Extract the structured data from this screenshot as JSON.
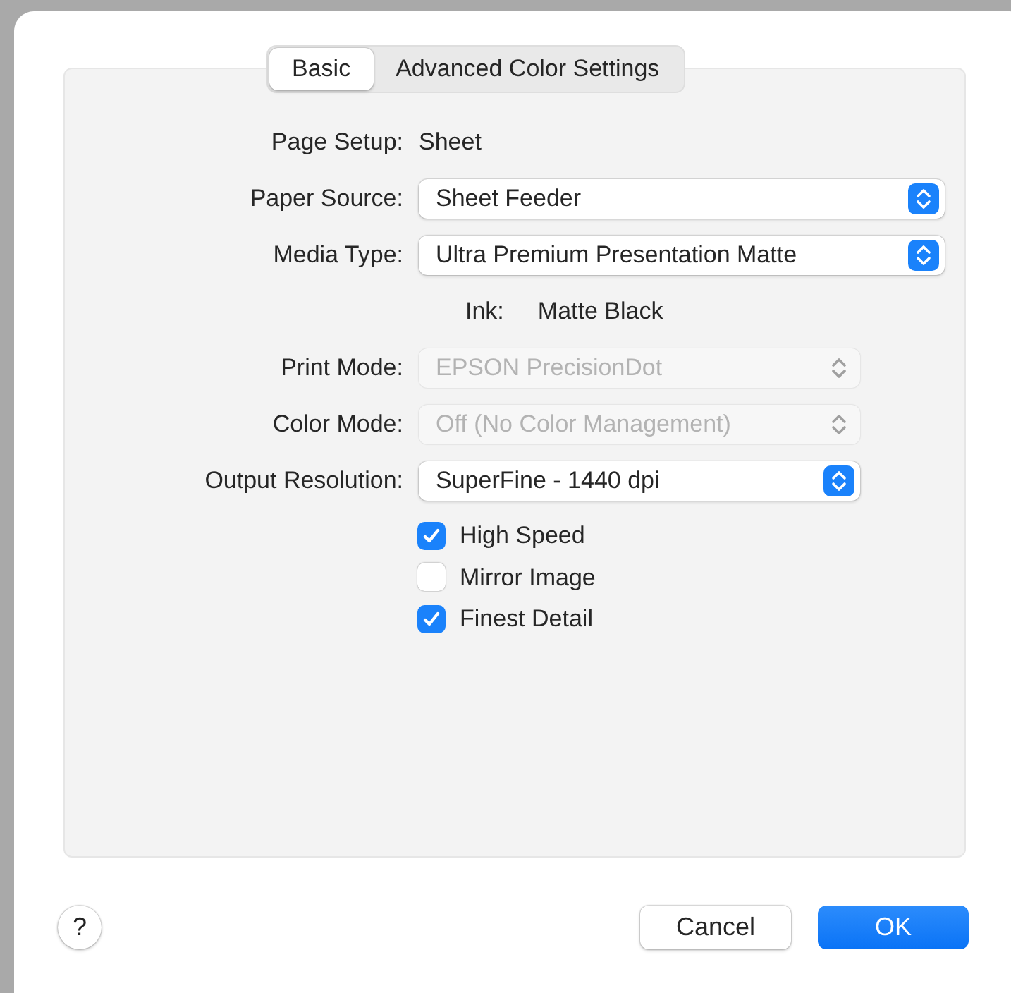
{
  "tabs": [
    {
      "label": "Basic",
      "selected": true
    },
    {
      "label": "Advanced Color Settings",
      "selected": false
    }
  ],
  "rows": [
    {
      "kind": "value",
      "label": "Page Setup:",
      "value": "Sheet"
    },
    {
      "kind": "popup_wide",
      "label": "Paper Source:",
      "value": "Sheet Feeder",
      "disabled": false
    },
    {
      "kind": "popup_wide",
      "label": "Media Type:",
      "value": "Ultra Premium Presentation Matte",
      "disabled": false
    },
    {
      "kind": "sub_value",
      "label": "Ink:",
      "value": "Matte Black"
    },
    {
      "kind": "popup",
      "label": "Print Mode:",
      "value": "EPSON PrecisionDot",
      "disabled": true
    },
    {
      "kind": "popup",
      "label": "Color Mode:",
      "value": "Off (No Color Management)",
      "disabled": true
    },
    {
      "kind": "popup",
      "label": "Output Resolution:",
      "value": "SuperFine - 1440 dpi",
      "disabled": false
    }
  ],
  "checkboxes": [
    {
      "label": "High Speed",
      "checked": true
    },
    {
      "label": "Mirror Image",
      "checked": false
    },
    {
      "label": "Finest Detail",
      "checked": true
    }
  ],
  "help": "?",
  "buttons": [
    {
      "label": "Cancel",
      "kind": "secondary"
    },
    {
      "label": "OK",
      "kind": "default"
    }
  ]
}
